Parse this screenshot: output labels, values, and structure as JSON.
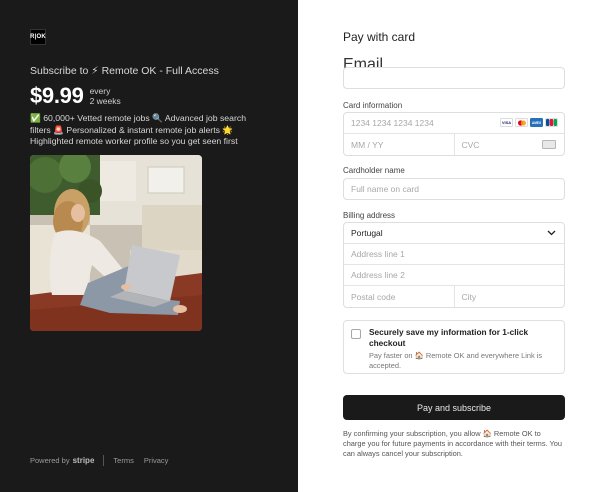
{
  "left": {
    "logo_text": "R|OK",
    "subscribe_title": "Subscribe to ⚡ Remote OK - Full Access",
    "price": "$9.99",
    "period_line1": "every",
    "period_line2": "2 weeks",
    "features": "✅ 60,000+ Vetted remote jobs 🔍 Advanced job search filters 🚨 Personalized & instant remote job alerts 🌟 Highlighted remote worker profile so you get seen first",
    "footer": {
      "powered_by": "Powered by",
      "stripe": "stripe",
      "terms": "Terms",
      "privacy": "Privacy"
    }
  },
  "right": {
    "title": "Pay with card",
    "email": {
      "label": "Email",
      "placeholder": ""
    },
    "card": {
      "label": "Card information",
      "number_placeholder": "1234 1234 1234 1234",
      "expiry_placeholder": "MM / YY",
      "cvc_placeholder": "CVC",
      "brands": [
        "VISA",
        "MC",
        "AMEX",
        "JCB"
      ]
    },
    "cardholder": {
      "label": "Cardholder name",
      "placeholder": "Full name on card"
    },
    "billing": {
      "label": "Billing address",
      "country": "Portugal",
      "address1_placeholder": "Address line 1",
      "address2_placeholder": "Address line 2",
      "postal_placeholder": "Postal code",
      "city_placeholder": "City"
    },
    "save": {
      "title": "Securely save my information for 1-click checkout",
      "description": "Pay faster on 🏠 Remote OK and everywhere Link is accepted."
    },
    "pay_button": "Pay and subscribe",
    "terms": "By confirming your subscription, you allow 🏠 Remote OK to charge you for future payments in accordance with their terms. You can always cancel your subscription."
  },
  "colors": {
    "left_bg": "#1a1a1a",
    "button_bg": "#1a1a1a",
    "border": "#dedede"
  }
}
